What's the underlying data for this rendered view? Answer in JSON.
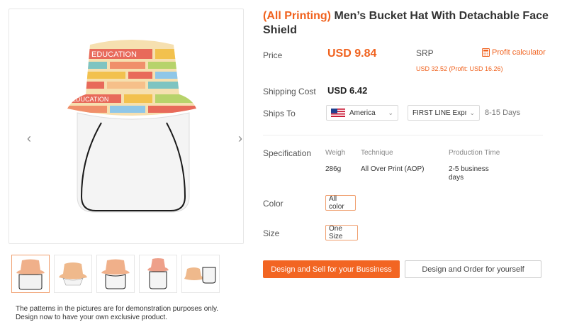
{
  "product": {
    "title_tag": "(All Printing)",
    "title_main": "Men’s Bucket Hat With Detachable Face Shield"
  },
  "gallery": {
    "prev_icon": "chevron-left-icon",
    "next_icon": "chevron-right-icon",
    "thumbnail_count": 5,
    "selected_thumbnail": 1
  },
  "disclaimer": {
    "line1": "The patterns in the pictures are for demonstration purposes only.",
    "line2": "Design now to have your own exclusive product."
  },
  "pricing": {
    "price_label": "Price",
    "price_value": "USD 9.84",
    "srp_label": "SRP",
    "srp_detail": "USD 32.52 (Profit: USD 16.26)",
    "profit_calculator": "Profit calculator",
    "profit_icon": "calculator-icon"
  },
  "shipping": {
    "cost_label": "Shipping Cost",
    "cost_value": "USD 6.42",
    "ships_to_label": "Ships To",
    "country": "America",
    "country_icon": "us-flag-icon",
    "method": "FIRST LINE Express",
    "days": "8-15 Days"
  },
  "specification": {
    "label": "Specification",
    "weight_label": "Weigh",
    "weight_value": "286g",
    "technique_label": "Technique",
    "technique_value": "All Over Print (AOP)",
    "production_label": "Production Time",
    "production_value_line1": "2-5 business",
    "production_value_line2": "days"
  },
  "options": {
    "color_label": "Color",
    "color_value": "All color",
    "size_label": "Size",
    "size_value": "One Size"
  },
  "actions": {
    "design_sell": "Design and Sell for your Bussiness",
    "design_order": "Design and Order for yourself"
  },
  "colors": {
    "accent": "#f26522",
    "text": "#333333"
  }
}
